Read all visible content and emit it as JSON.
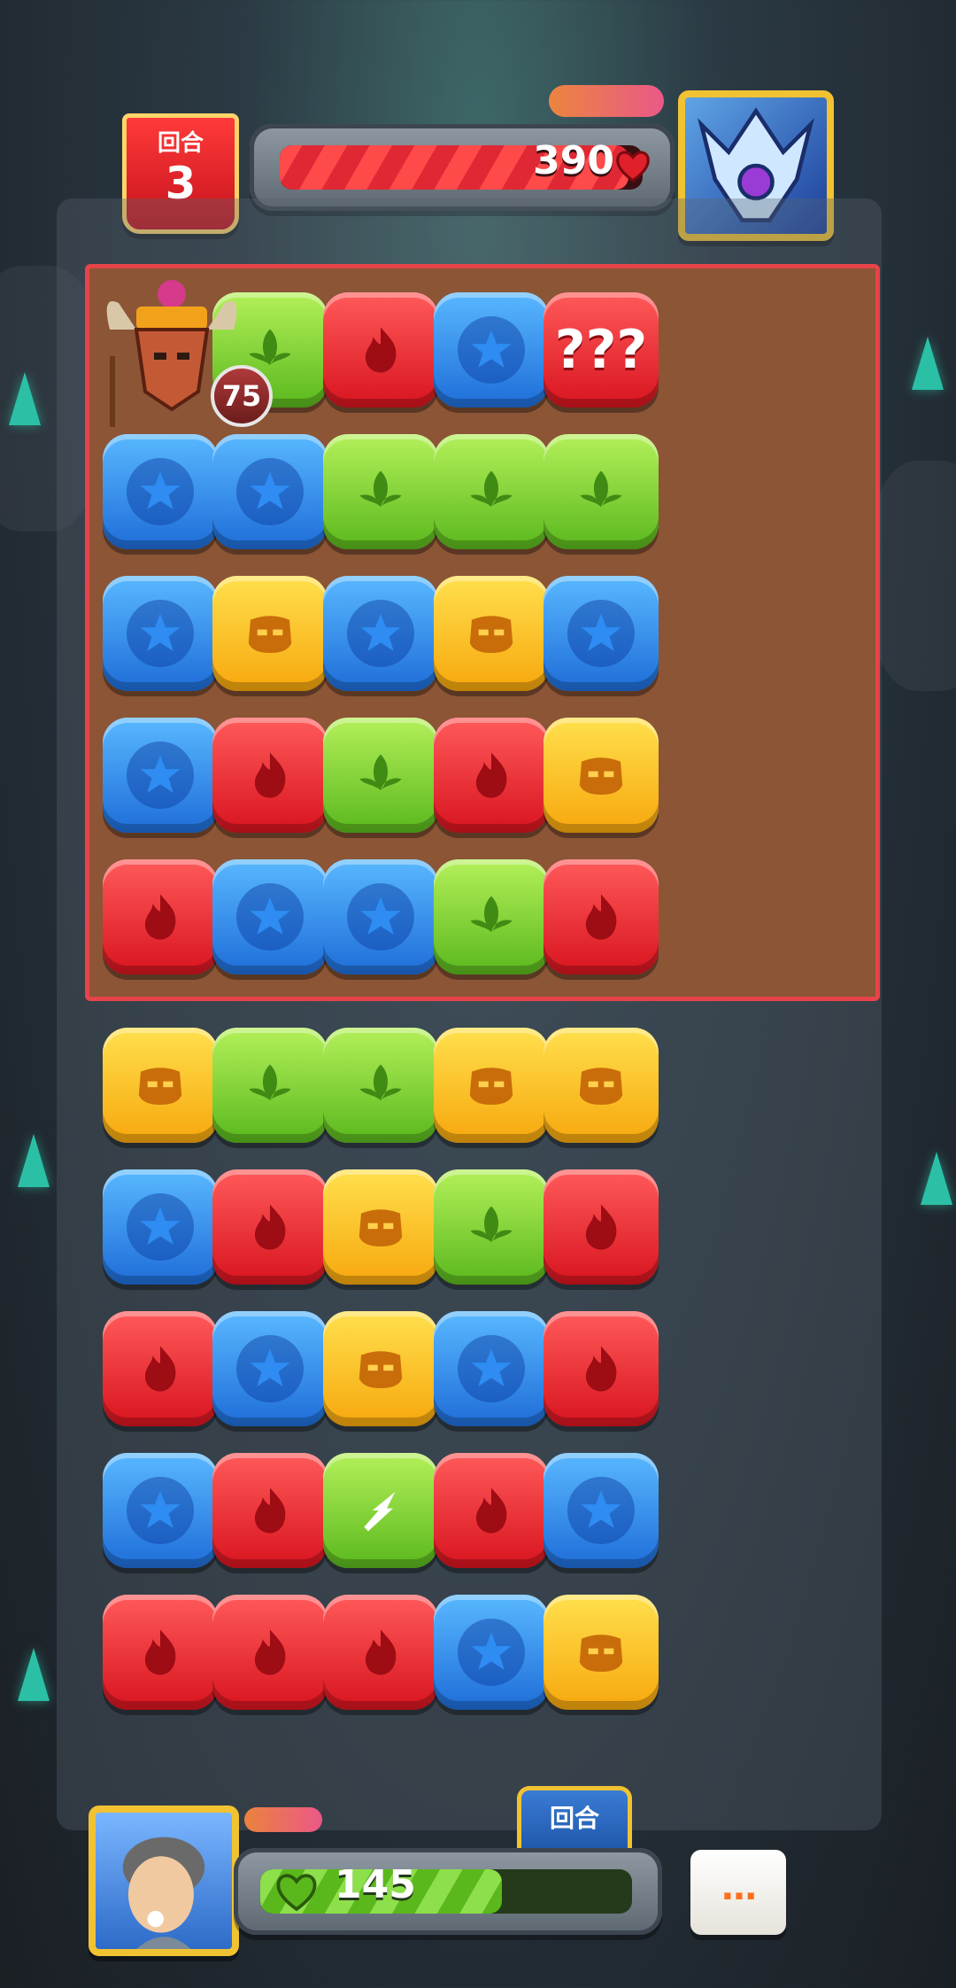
{
  "header": {
    "round_label": "回合",
    "round_number": "3",
    "enemy_hp": "390",
    "enemy_hp_fraction": 0.96
  },
  "boss": {
    "level": "75"
  },
  "board": {
    "tiles": [
      [
        "boss",
        "green",
        "red",
        "blue",
        "mystery"
      ],
      [
        "blue",
        "blue",
        "green",
        "green",
        "green"
      ],
      [
        "blue",
        "yellow",
        "blue",
        "yellow",
        "blue"
      ],
      [
        "blue",
        "red",
        "green",
        "red",
        "yellow"
      ],
      [
        "red",
        "blue",
        "blue",
        "green",
        "red"
      ],
      [
        "yellow",
        "green",
        "green",
        "yellow",
        "yellow"
      ],
      [
        "blue",
        "red",
        "yellow",
        "green",
        "red"
      ],
      [
        "red",
        "blue",
        "yellow",
        "blue",
        "red"
      ],
      [
        "blue",
        "red",
        "special",
        "red",
        "blue"
      ],
      [
        "red",
        "red",
        "red",
        "blue",
        "yellow"
      ]
    ],
    "mystery_label": "???"
  },
  "footer": {
    "turn_label": "回合",
    "player_hp": "145",
    "player_hp_fraction": 0.65,
    "menu_label": "..."
  },
  "colors": {
    "red": "#d8141f",
    "green": "#5ab81d",
    "blue": "#1e6dd8",
    "yellow": "#f7a70d"
  },
  "icons": {
    "red": "flame-icon",
    "green": "leaf-icon",
    "blue": "star-icon",
    "yellow": "skull-icon",
    "mystery": "question-marks-icon",
    "special": "lightning-icon"
  }
}
